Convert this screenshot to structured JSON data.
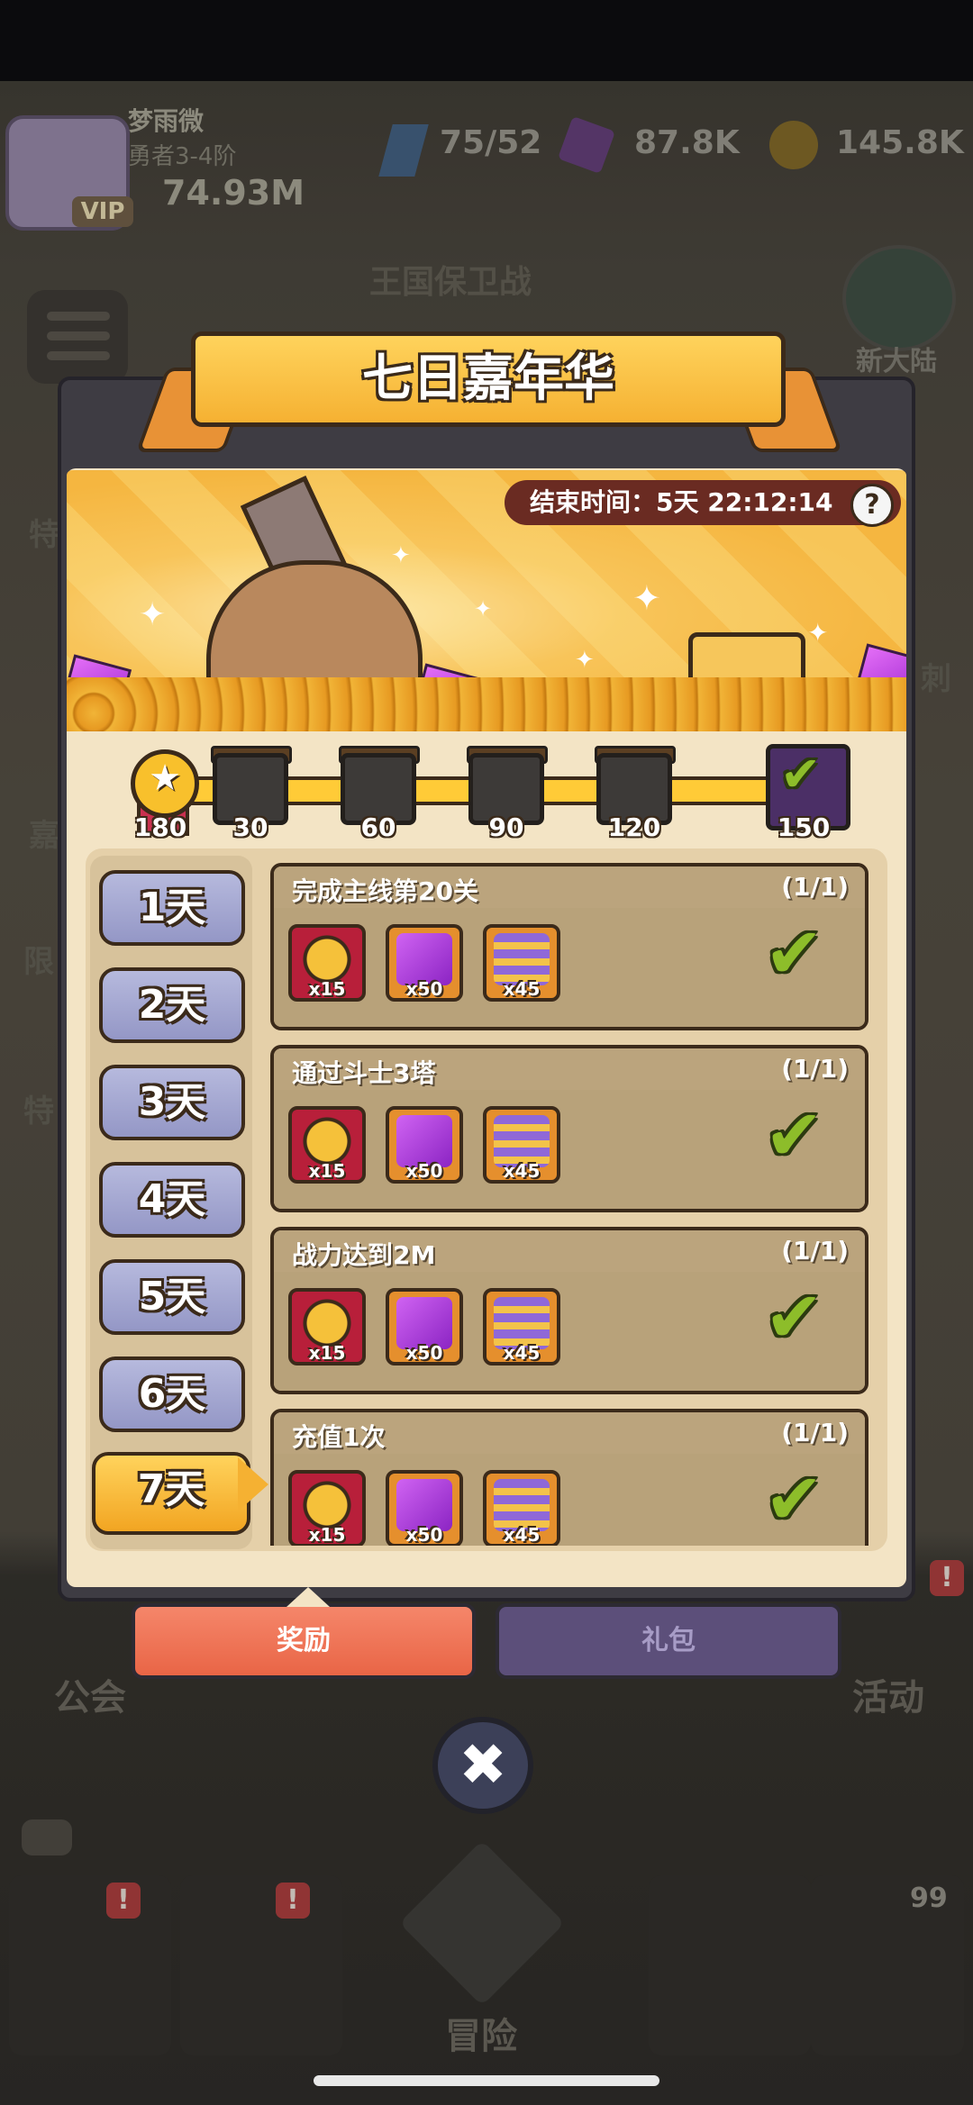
{
  "status_bar": {
    "player_name": "梦雨微",
    "player_rank": "勇者3-4阶",
    "vip_label": "VIP",
    "power": "74.93M",
    "energy": "75/52",
    "gems": "87.8K",
    "coins": "145.8K"
  },
  "background": {
    "kingdom_label": "王国保卫战",
    "new_continent_label": "新大陆",
    "side_labels": [
      "特",
      "嘉",
      "限",
      "特",
      "刺"
    ],
    "bottom_labels": {
      "guild": "公会",
      "event": "活动",
      "adventure": "冒险"
    },
    "event_badge": "99"
  },
  "dialog": {
    "title": "七日嘉年华",
    "timer": "结束时间：5天 22:12:14",
    "help": "?",
    "close": "✖"
  },
  "milestones": {
    "current_points": "180",
    "progress_fraction": 1.0,
    "items": [
      {
        "label": "30"
      },
      {
        "label": "60"
      },
      {
        "label": "90"
      },
      {
        "label": "120"
      },
      {
        "label": "150"
      }
    ]
  },
  "days": [
    {
      "label": "1天"
    },
    {
      "label": "2天"
    },
    {
      "label": "3天"
    },
    {
      "label": "4天"
    },
    {
      "label": "5天"
    },
    {
      "label": "6天"
    },
    {
      "label": "7天"
    }
  ],
  "selected_day": "7天",
  "tasks": [
    {
      "title": "完成主线第20关",
      "progress": "(1/1)",
      "rewards": [
        "x15",
        "x50",
        "x45"
      ]
    },
    {
      "title": "通过斗士3塔",
      "progress": "(1/1)",
      "rewards": [
        "x15",
        "x50",
        "x45"
      ]
    },
    {
      "title": "战力达到2M",
      "progress": "(1/1)",
      "rewards": [
        "x15",
        "x50",
        "x45"
      ]
    },
    {
      "title": "充值1次",
      "progress": "(1/1)",
      "rewards": [
        "x15",
        "x50",
        "x45"
      ]
    }
  ],
  "tabs": {
    "reward": "奖励",
    "gift": "礼包"
  },
  "colors": {
    "title_gold": "#f5b132",
    "reward_tab": "#e96546",
    "gift_tab": "#5c4f7a",
    "check_green": "#8dbd2a",
    "day_button": "#9497c6"
  }
}
